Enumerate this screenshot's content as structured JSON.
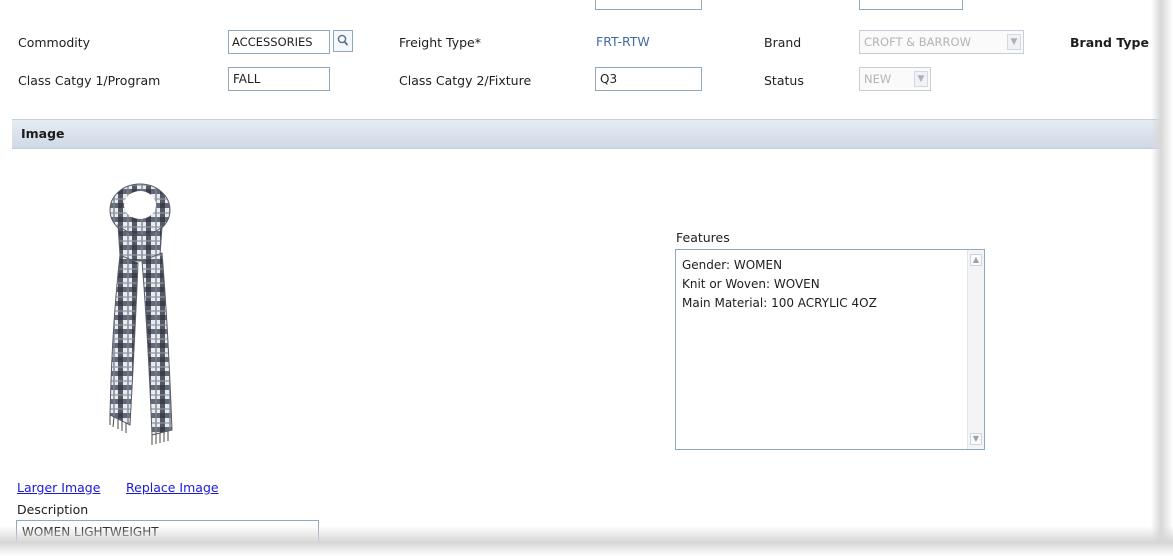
{
  "form": {
    "commodity": {
      "label": "Commodity",
      "value": "ACCESSORIES"
    },
    "freight_type": {
      "label": "Freight Type*",
      "value": "FRT-RTW"
    },
    "brand": {
      "label": "Brand",
      "value": "CROFT & BARROW"
    },
    "brand_type": {
      "label": "Brand Type"
    },
    "class_catgy_1": {
      "label": "Class Catgy 1/Program",
      "value": "FALL"
    },
    "class_catgy_2": {
      "label": "Class Catgy 2/Fixture",
      "value": "Q3"
    },
    "status": {
      "label": "Status",
      "value": "NEW"
    }
  },
  "image_section": {
    "title": "Image",
    "larger_image_link": "Larger Image",
    "replace_image_link": "Replace Image",
    "description_label": "Description",
    "description_value": "WOMEN LIGHTWEIGHT"
  },
  "features": {
    "label": "Features",
    "lines": [
      "Gender: WOMEN",
      "Knit or Woven: WOVEN",
      "Main Material: 100 ACRYLIC 4OZ"
    ]
  },
  "colors": {
    "section_bar": "#d6dfe9",
    "field_border": "#8fa8c4",
    "link": "#1a1adb",
    "readonly_value": "#3e6aa8"
  },
  "icons": [
    "search-icon",
    "dropdown-arrow-icon",
    "scroll-up-icon",
    "scroll-down-icon"
  ]
}
